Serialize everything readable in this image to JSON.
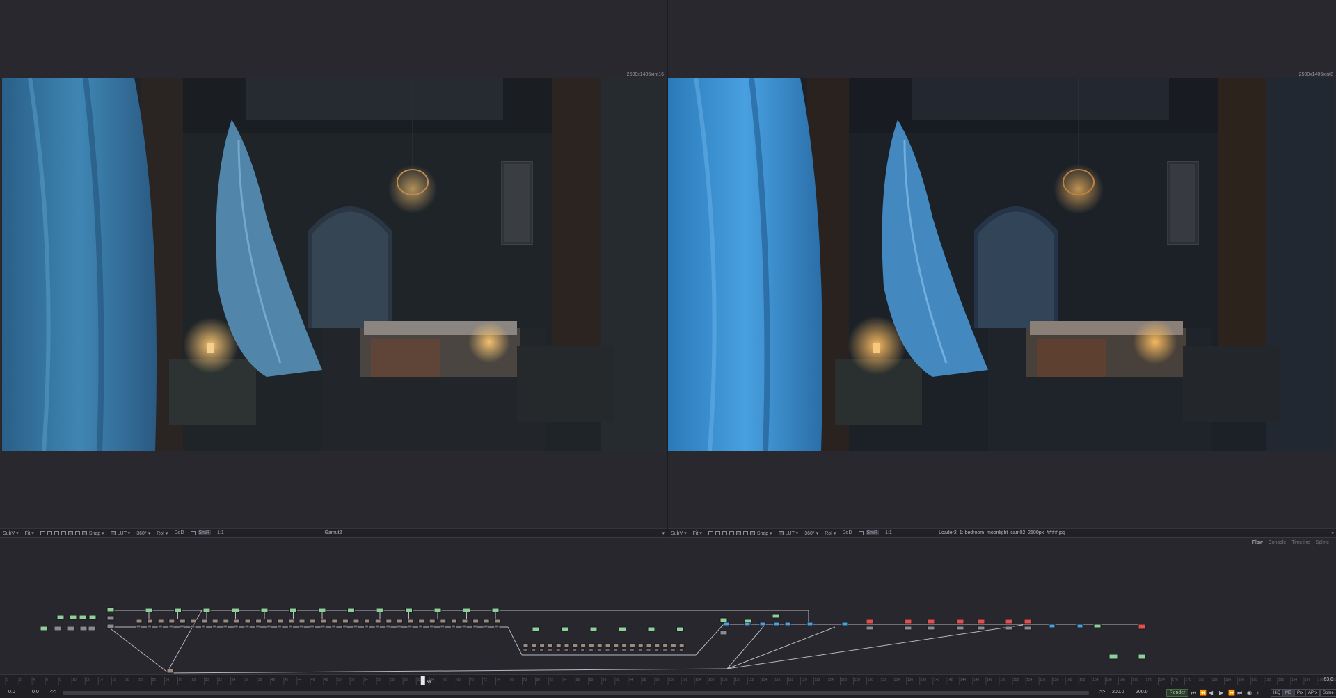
{
  "viewers": {
    "left": {
      "resolution": "2500x1406xint16",
      "toolbar_items": [
        "SubV ▾",
        "Fit ▾",
        "Snap ▾",
        "LUT ▾",
        "360° ▾",
        "RoI ▾",
        "DoD",
        "SmR",
        "1:1"
      ],
      "viewer_name": "Gamut2"
    },
    "right": {
      "resolution": "2500x1406xint8",
      "toolbar_items": [
        "SubV ▾",
        "Fit ▾",
        "Snap ▾",
        "LUT ▾",
        "360° ▾",
        "RoI ▾",
        "DoD",
        "SmR",
        "1:1"
      ],
      "viewer_name": "Loader2_1: bedroom_moonlight_cam02_2500px_####.jpg"
    }
  },
  "flow_panel": {
    "tabs": [
      "Flow",
      "Console",
      "Timeline",
      "Spline"
    ],
    "active_tab": "Flow"
  },
  "timeline": {
    "current_frame": "63",
    "current_time_display": "63.0",
    "global_start": "0.0",
    "render_start": "0.0",
    "render_end": "200.0",
    "global_end": "200.0",
    "render_label": "Render",
    "quality_buttons": [
      "HiQ",
      "MB",
      "Prx",
      "APrx",
      "Some"
    ],
    "ruler_start": 0,
    "ruler_end": 200,
    "ruler_step": 2
  },
  "colors": {
    "viewer_bg": "#28282e",
    "panel_bg": "#27272d",
    "loader_node": "#8fcf9a",
    "saver_node": "#e05050",
    "accent_blue": "#4aa0e0"
  }
}
